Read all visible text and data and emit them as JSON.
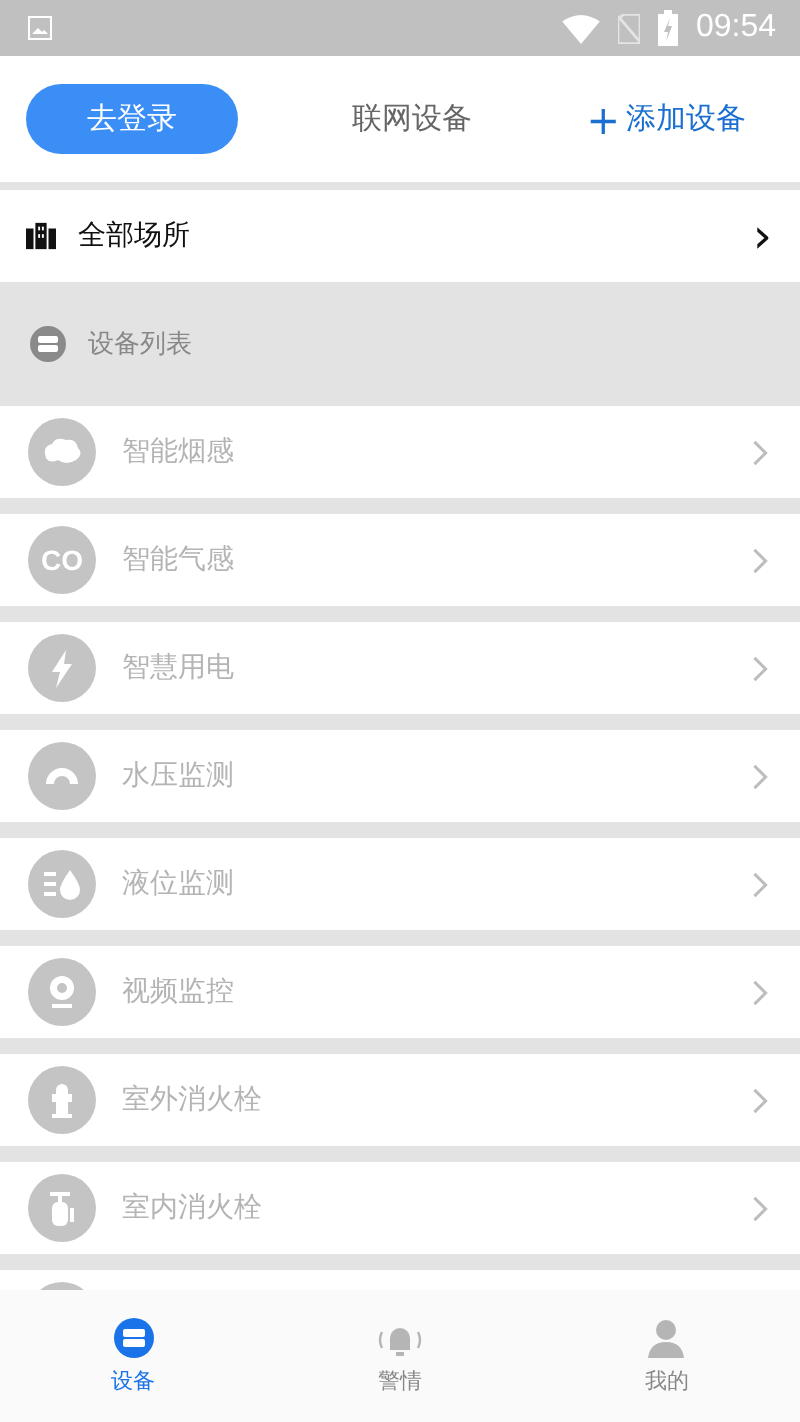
{
  "status_bar": {
    "time": "09:54"
  },
  "header": {
    "login_button": "去登录",
    "title": "联网设备",
    "add_button": {
      "icon": "+",
      "label": "添加设备"
    }
  },
  "location": {
    "label": "全部场所",
    "chevron": "›"
  },
  "section": {
    "title": "设备列表"
  },
  "devices": [
    {
      "kind": "smoke",
      "name": "智能烟感"
    },
    {
      "kind": "gas",
      "name": "智能气感",
      "icon_label": "CO"
    },
    {
      "kind": "power",
      "name": "智慧用电"
    },
    {
      "kind": "pressure",
      "name": "水压监测"
    },
    {
      "kind": "level",
      "name": "液位监测"
    },
    {
      "kind": "camera",
      "name": "视频监控"
    },
    {
      "kind": "outdoor_hydrant",
      "name": "室外消火栓"
    },
    {
      "kind": "indoor_hydrant",
      "name": "室内消火栓"
    },
    {
      "kind": "generic"
    }
  ],
  "nav": [
    {
      "kind": "devices",
      "label": "设备",
      "selected": true
    },
    {
      "kind": "alarm",
      "label": "警情",
      "selected": false
    },
    {
      "kind": "profile",
      "label": "我的",
      "selected": false
    }
  ]
}
